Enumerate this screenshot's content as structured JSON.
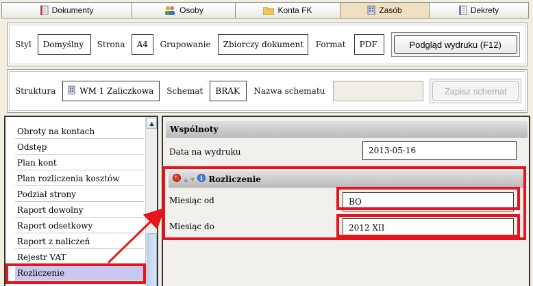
{
  "tabs": [
    {
      "label": "Dokumenty",
      "icon": "documents-icon"
    },
    {
      "label": "Osoby",
      "icon": "people-icon"
    },
    {
      "label": "Konta FK",
      "icon": "folder-icon"
    },
    {
      "label": "Zasób",
      "icon": "building-icon"
    },
    {
      "label": "Dekrety",
      "icon": "document-lines-icon"
    }
  ],
  "print_options": {
    "style_label": "Styl",
    "style_value": "Domyślny",
    "page_label": "Strona",
    "page_value": "A4",
    "grouping_label": "Grupowanie",
    "grouping_value": "Zbiorczy dokument",
    "format_label": "Format",
    "format_value": "PDF",
    "preview_button": "Podgląd wydruku (F12)"
  },
  "structure": {
    "structure_label": "Struktura",
    "structure_value": "WM 1 Zaliczkowa",
    "schema_label": "Schemat",
    "schema_value": "BRAK",
    "schema_name_label": "Nazwa schematu",
    "schema_name_value": "",
    "save_button": "Zapisz schemat"
  },
  "report_list": {
    "items": [
      "Obroty na kontach",
      "Odstęp",
      "Plan kont",
      "Plan rozliczenia kosztów",
      "Podział strony",
      "Raport dowolny",
      "Raport odsetkowy",
      "Raport z naliczeń",
      "Rejestr VAT",
      "Rozliczenie"
    ],
    "selected": "Rozliczenie"
  },
  "common": {
    "header": "Wspólnoty",
    "date_label": "Data na wydruku",
    "date_value": "2013-05-16"
  },
  "settlement": {
    "header": "Rozliczenie",
    "from_label": "Miesiąc od",
    "from_value": "BO",
    "to_label": "Miesiąc do",
    "to_value": "2012 XII"
  },
  "colors": {
    "highlight": "#e8141c",
    "active_tab": "#f0dfc0",
    "selected_item": "#c8c7f0"
  }
}
